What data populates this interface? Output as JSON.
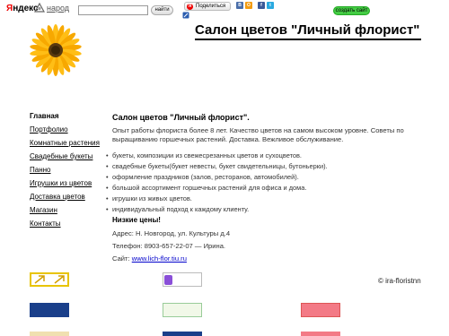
{
  "topbar": {
    "logo_ya": "Я",
    "logo_rest": "ндекс",
    "narod": "народ",
    "search_placeholder": "",
    "search_button": "найти",
    "share_label": "Поделиться",
    "create_site": "создать сайт",
    "social_icons": [
      {
        "name": "vkontakte-icon",
        "glyph": "В",
        "color": "#4a6ea9"
      },
      {
        "name": "odnoklassniki-icon",
        "glyph": "О",
        "color": "#f39c12"
      },
      {
        "name": "facebook-icon",
        "glyph": "f",
        "color": "#3b5998"
      },
      {
        "name": "twitter-icon",
        "glyph": "t",
        "color": "#2aa9e0"
      }
    ]
  },
  "header": {
    "title": "Салон цветов \"Личный флорист\""
  },
  "sidebar": {
    "items": [
      {
        "label": "Главная",
        "active": true
      },
      {
        "label": "Портфолио",
        "active": false
      },
      {
        "label": "Комнатные растения",
        "active": false
      },
      {
        "label": "Свадебные букеты",
        "active": false
      },
      {
        "label": "Панно",
        "active": false
      },
      {
        "label": "Игрушки из цветов",
        "active": false
      },
      {
        "label": "Доставка цветов",
        "active": false
      },
      {
        "label": "Магазин",
        "active": false
      },
      {
        "label": "Контакты",
        "active": false
      }
    ]
  },
  "content": {
    "heading": "Салон цветов \"Личный флорист\".",
    "intro": "Опыт работы флориста более 8 лет. Качество цветов на самом высоком уровне. Советы по выращиванию горшечных растений. Доставка. Вежливое обслуживание.",
    "services": [
      "букеты, композиции из свежесрезанных цветов и сухоцветов.",
      "свадебные букеты(букет невесты, букет свидетельницы, бутоньерки).",
      "оформление праздников (залов, ресторанов, автомобилей).",
      "большой ассортимент горшечных растений для офиса и дома.",
      "игрушки из живых цветов.",
      "индивидуальный подход к каждому клиенту."
    ],
    "prices": "Низкие цены!",
    "address": "Адрес: Н. Новгород, ул. Культуры д.4",
    "phone": "Телефон: 8903-657-22-07 — Ирина.",
    "site_prefix": "Сайт: ",
    "site_link": "www.lich-flor.tiu.ru"
  },
  "footer": {
    "copyright": "© ira-floristnn"
  },
  "colors": {
    "link": "#0000cc",
    "create_site_green": "#44cc44",
    "brand_red": "#ee0000"
  }
}
